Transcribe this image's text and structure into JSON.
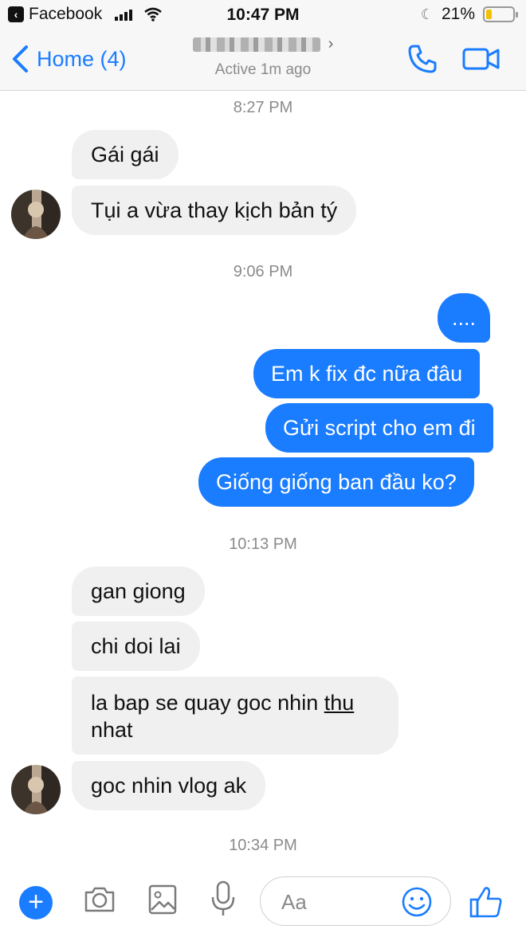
{
  "status_bar": {
    "app_name": "Facebook",
    "time": "10:47 PM",
    "battery": "21%",
    "battery_level": 0.21
  },
  "header": {
    "back_label": "Home (4)",
    "active_status": "Active 1m ago",
    "icons": [
      "chevron-left-icon",
      "phone-icon",
      "video-camera-icon"
    ]
  },
  "messages": {
    "ts1": "8:27 PM",
    "m1": "Gái gái",
    "m2": "Tụi a vừa thay kịch bản tý",
    "ts2": "9:06 PM",
    "m3": "....",
    "m4": "Em k fix đc nữa đâu",
    "m5": "Gửi script cho em đi",
    "m6": "Giống giống ban đầu ko?",
    "ts3": "10:13 PM",
    "m7": "gan giong",
    "m8": "chi doi lai",
    "m9_part1": "la bap se quay goc nhin ",
    "m9_underlined": "thu",
    "m9_part2": "nhat",
    "m10": "goc nhin vlog ak",
    "ts4": "10:34 PM"
  },
  "composer": {
    "placeholder": "Aa",
    "icons": [
      "plus-icon",
      "camera-icon",
      "image-icon",
      "microphone-icon",
      "emoji-icon",
      "thumbs-up-icon"
    ]
  },
  "colors": {
    "accent": "#1a7cff",
    "incoming_bubble": "#f0f0f0",
    "timestamp_text": "#8b8b8b"
  }
}
